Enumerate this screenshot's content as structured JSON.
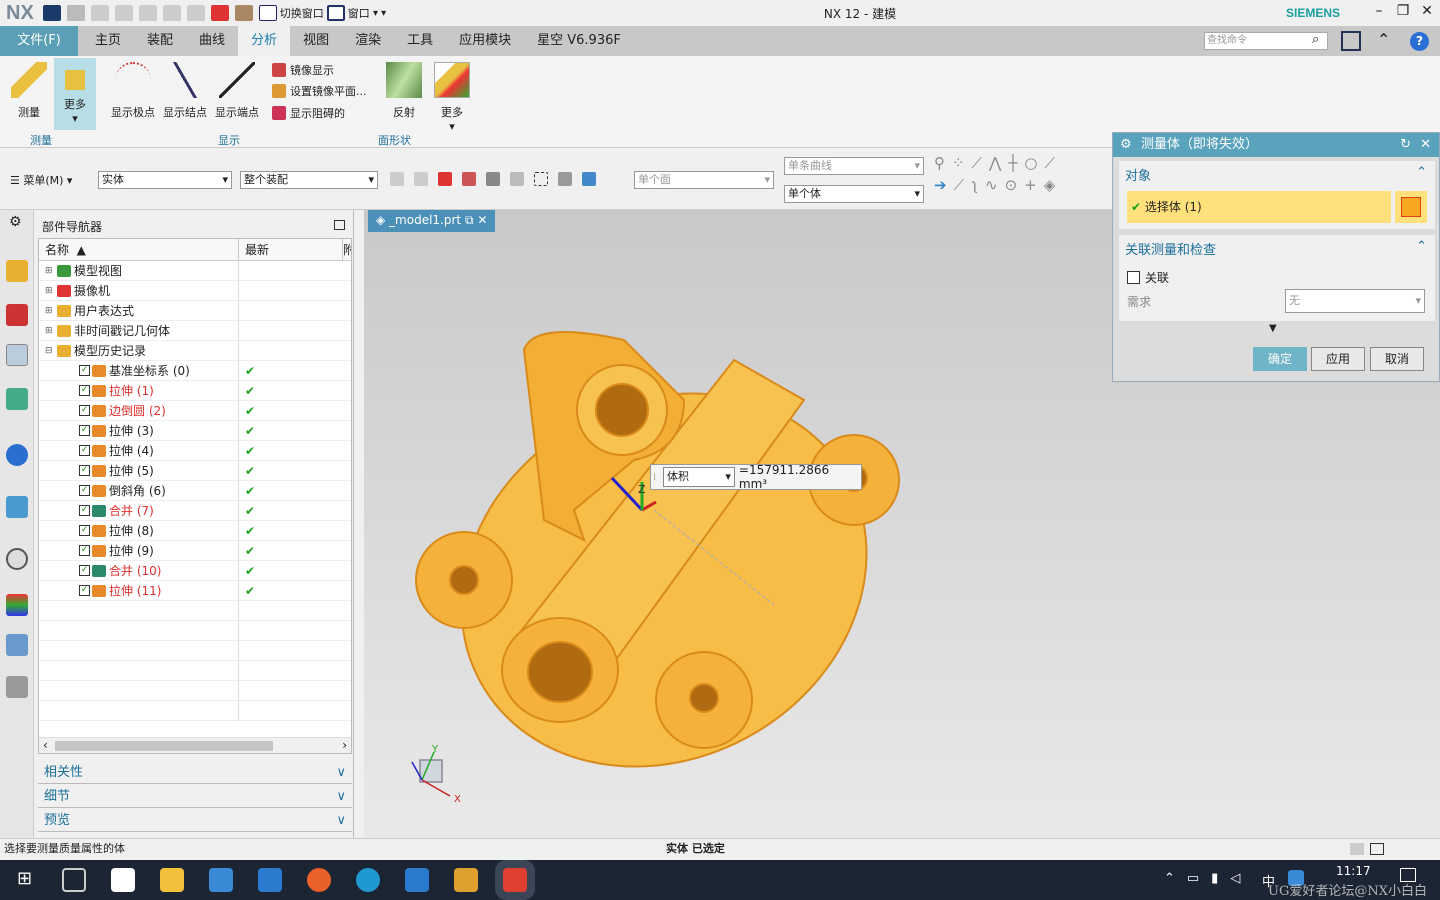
{
  "app": {
    "logo": "NX",
    "title": "NX 12 - 建模",
    "brand": "SIEMENS",
    "switch_window": "切换窗口",
    "window_menu": "窗口"
  },
  "menu": {
    "file": "文件(F)",
    "tabs": [
      "主页",
      "装配",
      "曲线",
      "分析",
      "视图",
      "渲染",
      "工具",
      "应用模块",
      "星空 V6.936F"
    ],
    "active": "分析",
    "search_placeholder": "查找命令"
  },
  "ribbon": {
    "measure": "测量",
    "more1": "更多",
    "show_poles": "显示极点",
    "show_knots": "显示结点",
    "show_ends": "显示端点",
    "mirror_display": "镜像显示",
    "set_mirror_plane": "设置镜像平面...",
    "show_blocked": "显示阻碍的",
    "reflection": "反射",
    "more2": "更多",
    "group_measure": "测量",
    "group_display": "显示",
    "group_face_shape": "面形状"
  },
  "toolbar": {
    "menu": "菜单(M)",
    "filter_type": "实体",
    "scope": "整个装配",
    "face_rule": "单个面",
    "curve_rule": "单条曲线",
    "body_rule": "单个体"
  },
  "navigator": {
    "title": "部件导航器",
    "col_name": "名称",
    "col_latest": "最新",
    "col_extra": "附",
    "items": [
      {
        "label": "模型视图",
        "level": 0,
        "red": false,
        "check": false
      },
      {
        "label": "摄像机",
        "level": 0,
        "red": false,
        "check": false
      },
      {
        "label": "用户表达式",
        "level": 0,
        "red": false,
        "check": false
      },
      {
        "label": "非时间戳记几何体",
        "level": 0,
        "red": false,
        "check": false
      },
      {
        "label": "模型历史记录",
        "level": 0,
        "red": false,
        "check": false
      },
      {
        "label": "基准坐标系 (0)",
        "level": 1,
        "red": false,
        "check": true
      },
      {
        "label": "拉伸 (1)",
        "level": 1,
        "red": true,
        "check": true
      },
      {
        "label": "边倒圆 (2)",
        "level": 1,
        "red": true,
        "check": true
      },
      {
        "label": "拉伸 (3)",
        "level": 1,
        "red": false,
        "check": true
      },
      {
        "label": "拉伸 (4)",
        "level": 1,
        "red": false,
        "check": true
      },
      {
        "label": "拉伸 (5)",
        "level": 1,
        "red": false,
        "check": true
      },
      {
        "label": "倒斜角 (6)",
        "level": 1,
        "red": false,
        "check": true
      },
      {
        "label": "合并 (7)",
        "level": 1,
        "red": true,
        "check": true
      },
      {
        "label": "拉伸 (8)",
        "level": 1,
        "red": false,
        "check": true
      },
      {
        "label": "拉伸 (9)",
        "level": 1,
        "red": false,
        "check": true
      },
      {
        "label": "合并 (10)",
        "level": 1,
        "red": true,
        "check": true
      },
      {
        "label": "拉伸 (11)",
        "level": 1,
        "red": true,
        "check": true
      }
    ],
    "panels": [
      "相关性",
      "细节",
      "预览"
    ]
  },
  "viewport": {
    "tab": "_model1.prt",
    "measure_type": "体积",
    "measure_value": "=157911.2866 mm³",
    "axes": {
      "x": "X",
      "y": "Y",
      "z": "Z"
    }
  },
  "dialog": {
    "title": "测量体（即将失效）",
    "section_object": "对象",
    "select_body": "选择体 (1)",
    "section_assoc": "关联测量和检查",
    "assoc_label": "关联",
    "requirement_label": "需求",
    "requirement_value": "无",
    "ok": "确定",
    "apply": "应用",
    "cancel": "取消"
  },
  "status": {
    "left": "选择要测量质量属性的体",
    "center": "实体 已选定"
  },
  "taskbar": {
    "time": "11:17",
    "ime": "中",
    "watermark": "UG爱好者论坛@NX小白白"
  },
  "colors": {
    "accent": "#5aa3bc",
    "model": "#f5b642",
    "selection": "#ffe07a"
  }
}
